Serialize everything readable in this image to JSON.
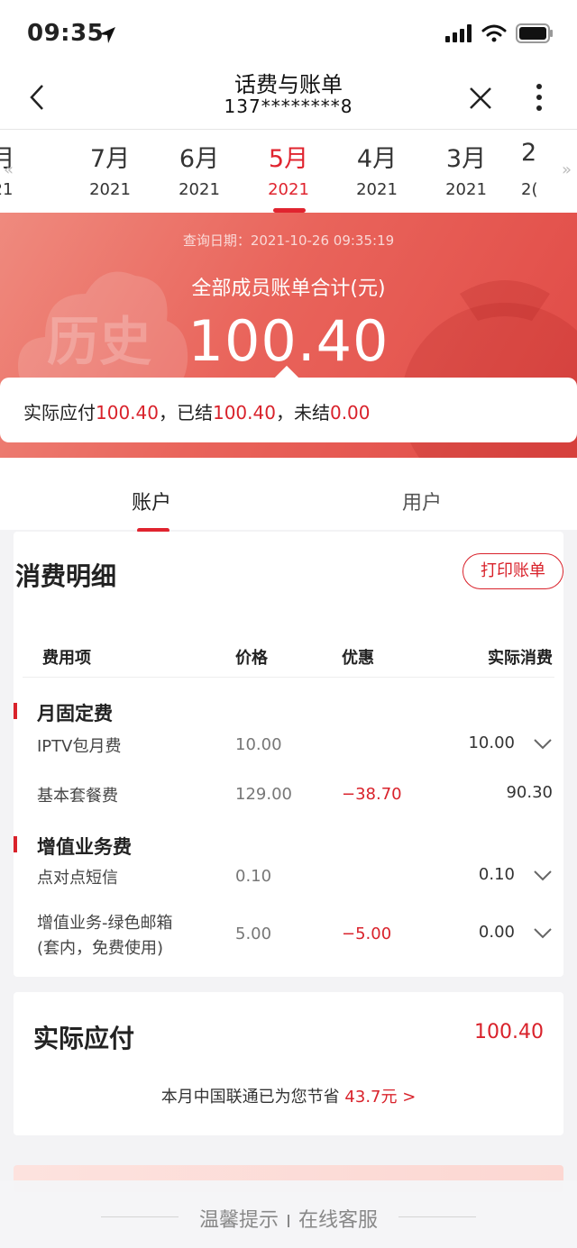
{
  "status": {
    "time": "09:35"
  },
  "nav": {
    "title": "话费与账单",
    "phone": "137********8"
  },
  "months": [
    {
      "m": "月",
      "y": "21",
      "partial": "left"
    },
    {
      "m": "7月",
      "y": "2021"
    },
    {
      "m": "6月",
      "y": "2021"
    },
    {
      "m": "5月",
      "y": "2021",
      "active": true
    },
    {
      "m": "4月",
      "y": "2021"
    },
    {
      "m": "3月",
      "y": "2021"
    },
    {
      "m": "2",
      "y": "2(",
      "partial": "right"
    }
  ],
  "hero": {
    "query_date": "查询日期：2021-10-26 09:35:19",
    "caption": "全部成员账单合计(元)",
    "amount": "100.40",
    "watermark": "历史"
  },
  "summary": {
    "label1": "实际应付",
    "value1": "100.40",
    "label2": "，已结",
    "value2": "100.40",
    "label3": "，未结",
    "value3": "0.00"
  },
  "tabs": {
    "account": "账户",
    "user": "用户"
  },
  "detail": {
    "title": "消费明细",
    "print_label": "打印账单",
    "headers": {
      "item": "费用项",
      "price": "价格",
      "discount": "优惠",
      "actual": "实际消费"
    },
    "groups": [
      {
        "name": "月固定费",
        "rows": [
          {
            "name": "IPTV包月费",
            "price": "10.00",
            "discount": "",
            "actual": "10.00",
            "expand": true
          },
          {
            "name": "基本套餐费",
            "price": "129.00",
            "discount": "−38.70",
            "actual": "90.30",
            "expand": false
          }
        ]
      },
      {
        "name": "增值业务费",
        "rows": [
          {
            "name": "点对点短信",
            "price": "0.10",
            "discount": "",
            "actual": "0.10",
            "expand": true
          },
          {
            "name": "增值业务-绿色邮箱",
            "name2": "(套内，免费使用)",
            "price": "5.00",
            "discount": "−5.00",
            "actual": "0.00",
            "expand": true
          }
        ]
      }
    ]
  },
  "pay": {
    "title": "实际应付",
    "amount": "100.40",
    "save_text": "本月中国联通已为您节省",
    "save_amount": "43.7元 >"
  },
  "footer": {
    "tip": "温馨提示",
    "service": "在线客服"
  },
  "colors": {
    "accent": "#d9222b",
    "hero_start": "#ef8a7e",
    "hero_end": "#e04945"
  }
}
